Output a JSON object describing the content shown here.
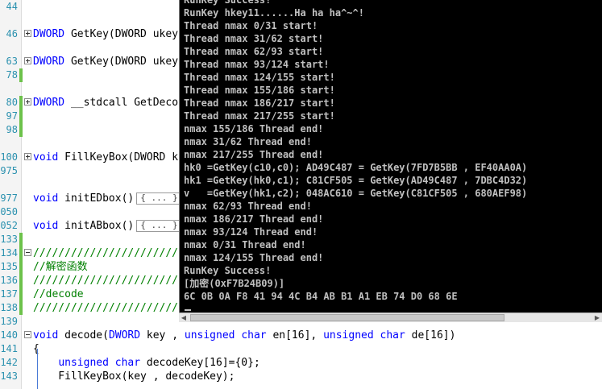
{
  "editor": {
    "lines": [
      {
        "num": "44"
      },
      {
        "num": "46",
        "segs": [
          {
            "c": "kw",
            "t": "DWORD"
          },
          {
            "c": "tx",
            "t": " GetKey(DWORD ukey"
          }
        ]
      },
      {
        "num": "63",
        "segs": [
          {
            "c": "kw",
            "t": "DWORD"
          },
          {
            "c": "tx",
            "t": " GetKey(DWORD ukey"
          }
        ]
      },
      {
        "num": "78"
      },
      {
        "num": "80",
        "segs": [
          {
            "c": "kw",
            "t": "DWORD"
          },
          {
            "c": "tx",
            "t": " __stdcall GetDeco"
          }
        ]
      },
      {
        "num": "97"
      },
      {
        "num": "98"
      },
      {
        "num": "100",
        "segs": [
          {
            "c": "kw",
            "t": "void"
          },
          {
            "c": "tx",
            "t": " FillKeyBox(DWORD k"
          }
        ]
      },
      {
        "num": "975"
      },
      {
        "num": "977",
        "segs": [
          {
            "c": "kw",
            "t": "void"
          },
          {
            "c": "tx",
            "t": " initEDbox()"
          }
        ],
        "box": "{ ... }"
      },
      {
        "num": "050"
      },
      {
        "num": "052",
        "segs": [
          {
            "c": "kw",
            "t": "void"
          },
          {
            "c": "tx",
            "t": " initABbox()"
          }
        ],
        "box": "{ ... }"
      },
      {
        "num": "133"
      },
      {
        "num": "134",
        "segs": [
          {
            "c": "cm",
            "t": "///////////////////////"
          }
        ]
      },
      {
        "num": "135",
        "segs": [
          {
            "c": "cm",
            "t": "//解密函数"
          }
        ]
      },
      {
        "num": "136",
        "segs": [
          {
            "c": "cm",
            "t": "///////////////////////"
          }
        ]
      },
      {
        "num": "137",
        "segs": [
          {
            "c": "cm",
            "t": "//decode"
          }
        ]
      },
      {
        "num": "138",
        "segs": [
          {
            "c": "cm",
            "t": "///////////////////////"
          }
        ]
      },
      {
        "num": "139"
      },
      {
        "num": "140",
        "segs": [
          {
            "c": "kw",
            "t": "void"
          },
          {
            "c": "tx",
            "t": " decode("
          },
          {
            "c": "kw",
            "t": "DWORD"
          },
          {
            "c": "tx",
            "t": " key , "
          },
          {
            "c": "kw",
            "t": "unsigned char"
          },
          {
            "c": "tx",
            "t": " en[16], "
          },
          {
            "c": "kw",
            "t": "unsigned char"
          },
          {
            "c": "tx",
            "t": " de[16])"
          }
        ]
      },
      {
        "num": "141",
        "segs": [
          {
            "c": "tx",
            "t": "{"
          }
        ]
      },
      {
        "num": "142",
        "segs": [
          {
            "c": "tx",
            "t": "    "
          },
          {
            "c": "kw",
            "t": "unsigned char"
          },
          {
            "c": "tx",
            "t": " decodeKey[16]={0};"
          }
        ]
      },
      {
        "num": "143",
        "segs": [
          {
            "c": "tx",
            "t": "    FillKeyBox(key , decodeKey);"
          }
        ]
      }
    ]
  },
  "console": {
    "lines": [
      "RunKey Success!",
      "RunKey hkey11......Ha ha ha^~^!",
      "Thread nmax 0/31 start!",
      "Thread nmax 31/62 start!",
      "Thread nmax 62/93 start!",
      "Thread nmax 93/124 start!",
      "Thread nmax 124/155 start!",
      "Thread nmax 155/186 start!",
      "Thread nmax 186/217 start!",
      "Thread nmax 217/255 start!",
      "nmax 155/186 Thread end!",
      "nmax 31/62 Thread end!",
      "nmax 217/255 Thread end!",
      "hk0 =GetKey(c10,c0); AD49C487 = GetKey(7FD7B5BB , EF40AA0A)",
      "hk1 =GetKey(hk0,c1); C81CF505 = GetKey(AD49C487 , 7DBC4D32)",
      "v   =GetKey(hk1,c2); 048AC610 = GetKey(C81CF505 , 680AEF98)",
      "nmax 62/93 Thread end!",
      "nmax 186/217 Thread end!",
      "nmax 93/124 Thread end!",
      "nmax 0/31 Thread end!",
      "nmax 124/155 Thread end!",
      "RunKey Success!",
      "[加密(0xF7B24B09)]",
      "6C 0B 0A F8 41 94 4C B4 AB B1 A1 EB 74 D0 68 6E"
    ]
  },
  "colors": {
    "console_bg": "#000000",
    "console_fg": "#c0c0c0",
    "keyword": "#0000ff",
    "comment": "#008000",
    "line_number": "#2b91af"
  }
}
